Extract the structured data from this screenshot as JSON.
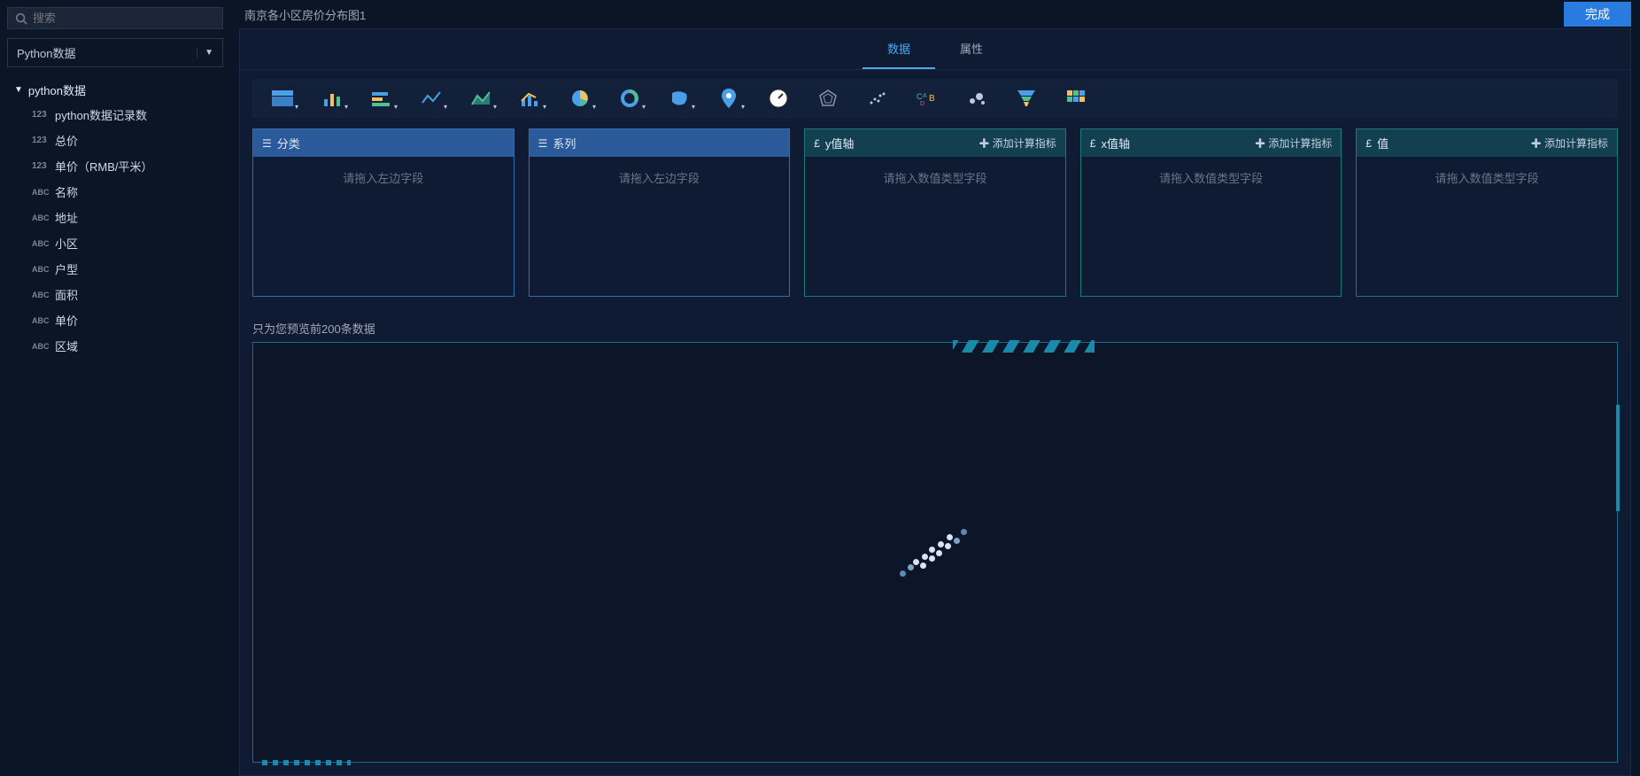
{
  "sidebar": {
    "search_placeholder": "搜索",
    "select_value": "Python数据",
    "tree_label": "python数据",
    "fields": [
      {
        "type": "123",
        "label": "python数据记录数"
      },
      {
        "type": "123",
        "label": "总价"
      },
      {
        "type": "123",
        "label": "单价（RMB/平米）"
      },
      {
        "type": "ABC",
        "label": "名称"
      },
      {
        "type": "ABC",
        "label": "地址"
      },
      {
        "type": "ABC",
        "label": "小区"
      },
      {
        "type": "ABC",
        "label": "户型"
      },
      {
        "type": "ABC",
        "label": "面积"
      },
      {
        "type": "ABC",
        "label": "单价"
      },
      {
        "type": "ABC",
        "label": "区域"
      }
    ]
  },
  "header": {
    "title": "南京各小区房价分布图1",
    "done_button": "完成"
  },
  "tabs": {
    "data": "数据",
    "attr": "属性"
  },
  "chart_icons": [
    "table-chart-icon",
    "bar-chart-icon",
    "hbar-chart-icon",
    "line-chart-icon",
    "area-chart-icon",
    "combo-chart-icon",
    "pie-chart-icon",
    "ring-chart-icon",
    "map-china-icon",
    "map-point-icon",
    "gauge-icon",
    "radar-icon",
    "scatter-icon",
    "word-cloud-icon",
    "bubble-icon",
    "funnel-icon",
    "heatmap-icon"
  ],
  "zones": {
    "category": {
      "label": "分类",
      "placeholder": "请拖入左边字段"
    },
    "series": {
      "label": "系列",
      "placeholder": "请拖入左边字段"
    },
    "yaxis": {
      "label": "y值轴",
      "placeholder": "请拖入数值类型字段",
      "add": "添加计算指标"
    },
    "xaxis": {
      "label": "x值轴",
      "placeholder": "请拖入数值类型字段",
      "add": "添加计算指标"
    },
    "value": {
      "label": "值",
      "placeholder": "请拖入数值类型字段",
      "add": "添加计算指标"
    }
  },
  "preview_label": "只为您预览前200条数据"
}
